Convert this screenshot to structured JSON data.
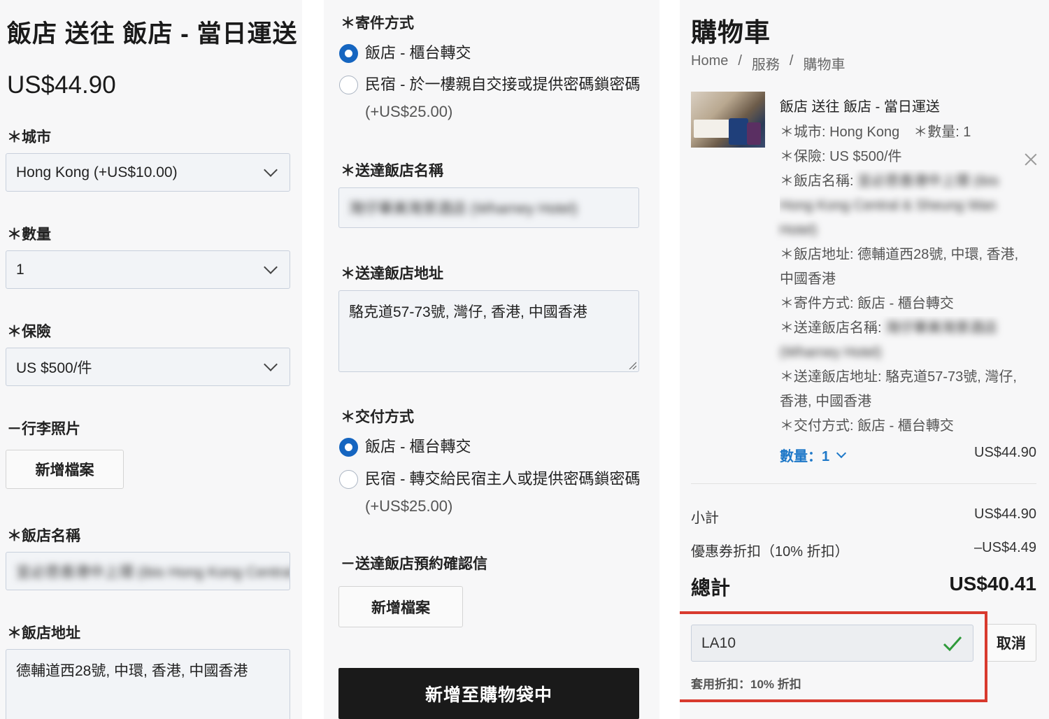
{
  "product_form": {
    "title": "飯店 送往 飯店 - 當日運送",
    "price": "US$44.90",
    "city_label": "＊城市",
    "city_value": "Hong Kong (+US$10.00)",
    "quantity_label": "＊數量",
    "quantity_value": "1",
    "insurance_label": "＊保險",
    "insurance_value": "US $500/件",
    "luggage_photo_label": "－行李照片",
    "add_file_label": "新增檔案",
    "hotel_name_label": "＊飯店名稱",
    "hotel_name_value": "宜必思香港中上環 (ibis Hong Kong Central",
    "hotel_address_label": "＊飯店地址",
    "hotel_address_value": "德輔道西28號, 中環, 香港, 中國香港"
  },
  "delivery_form": {
    "send_method_label": "＊寄件方式",
    "send_options": [
      {
        "label": "飯店 - 櫃台轉交",
        "extra": "",
        "selected": true
      },
      {
        "label": "民宿 - 於一樓親自交接或提供密碼鎖密碼",
        "extra": "(+US$25.00)",
        "selected": false
      }
    ],
    "dest_hotel_name_label": "＊送達飯店名稱",
    "dest_hotel_name_value": "灣仔華美灣景酒店 (Wharney Hotel)",
    "dest_hotel_address_label": "＊送達飯店地址",
    "dest_hotel_address_value": "駱克道57-73號, 灣仔, 香港, 中國香港",
    "delivery_method_label": "＊交付方式",
    "delivery_options": [
      {
        "label": "飯店 - 櫃台轉交",
        "extra": "",
        "selected": true
      },
      {
        "label": "民宿 - 轉交給民宿主人或提供密碼鎖密碼",
        "extra": "(+US$25.00)",
        "selected": false
      }
    ],
    "confirmation_label": "－送達飯店預約確認信",
    "add_file_label": "新增檔案",
    "add_to_bag_label": "新增至購物袋中"
  },
  "cart": {
    "title": "購物車",
    "breadcrumb": [
      "Home",
      "/",
      "服務",
      "/",
      "購物車"
    ],
    "item": {
      "title": "飯店 送往 飯店 - 當日運送",
      "opt_city_qty": "＊城市: Hong Kong　＊數量: 1",
      "opt_insurance": "＊保險: US $500/件",
      "opt_hotel_name_prefix": "＊飯店名稱:",
      "opt_hotel_name_blur": "宜必思香港中上環 (ibis",
      "opt_hotel_name_blur2": "Hong Kong Central & Sheung Wan",
      "opt_hotel_name_blur3": "Hotel)",
      "opt_hotel_addr_1": "＊飯店地址: 德輔道西28號, 中環, 香港,",
      "opt_hotel_addr_2": "中國香港",
      "opt_send_method": "＊寄件方式: 飯店 - 櫃台轉交",
      "opt_dest_name_prefix": "＊送達飯店名稱:",
      "opt_dest_name_blur": "灣仔華美灣景酒店",
      "opt_dest_name_blur2": "(Wharney Hotel)",
      "opt_dest_addr_1": "＊送達飯店地址: 駱克道57-73號, 灣仔,",
      "opt_dest_addr_2": "香港, 中國香港",
      "opt_delivery_method": "＊交付方式: 飯店 - 櫃台轉交",
      "qty_label": "數量：1",
      "price": "US$44.90"
    },
    "subtotal_label": "小計",
    "subtotal_value": "US$44.90",
    "discount_label": "優惠券折扣（10% 折扣）",
    "discount_value": "–US$4.49",
    "total_label": "總計",
    "total_value": "US$40.41",
    "coupon_code": "LA10",
    "cancel_label": "取消",
    "applied_text": "套用折扣：10% 折扣",
    "accent_color": "#1e78c8",
    "highlight_color": "#d83a2e",
    "check_color": "#2e9a3a"
  }
}
